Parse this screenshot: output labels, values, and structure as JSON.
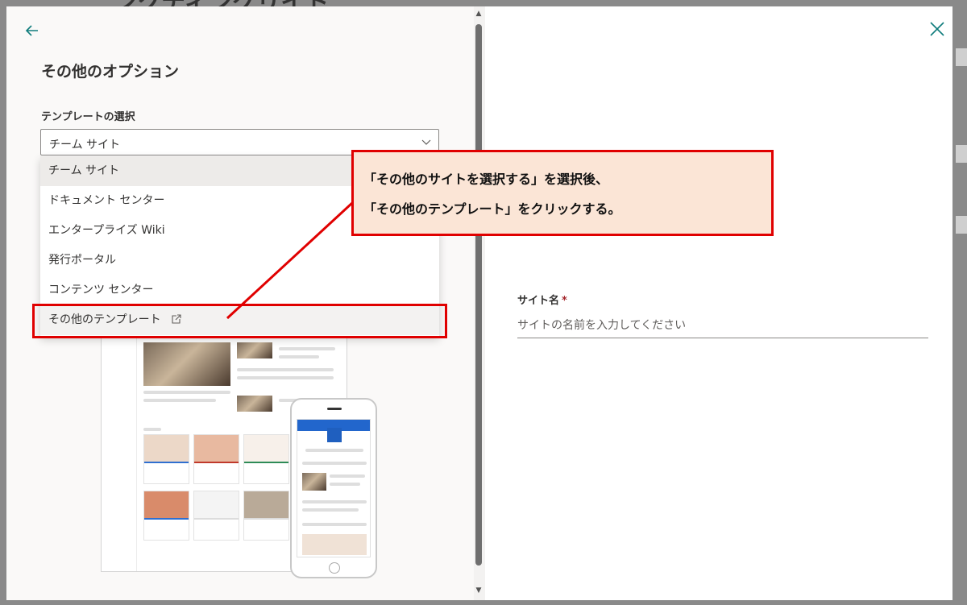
{
  "background": {
    "title_fragment": "ンクティングリイト"
  },
  "panel": {
    "title": "その他のオプション",
    "template_label": "テンプレートの選択",
    "selected_template": "チーム サイト",
    "options": [
      "チーム サイト",
      "ドキュメント センター",
      "エンタープライズ Wiki",
      "発行ポータル",
      "コンテンツ センター",
      "その他のテンプレート"
    ]
  },
  "form": {
    "site_name_label": "サイト名",
    "required_mark": "*",
    "site_name_placeholder": "サイトの名前を入力してください"
  },
  "annotation": {
    "line1": "「その他のサイトを選択する」を選択後、",
    "line2": "「その他のテンプレート」をクリックする。"
  },
  "colors": {
    "accent": "#0f7c7c",
    "annotation_border": "#e00000",
    "annotation_fill": "#fbe5d6",
    "required": "#a4262c"
  },
  "icons": {
    "back": "arrow-left-icon",
    "close": "close-icon",
    "dropdown": "chevron-down-icon",
    "external": "open-in-new-window-icon"
  }
}
